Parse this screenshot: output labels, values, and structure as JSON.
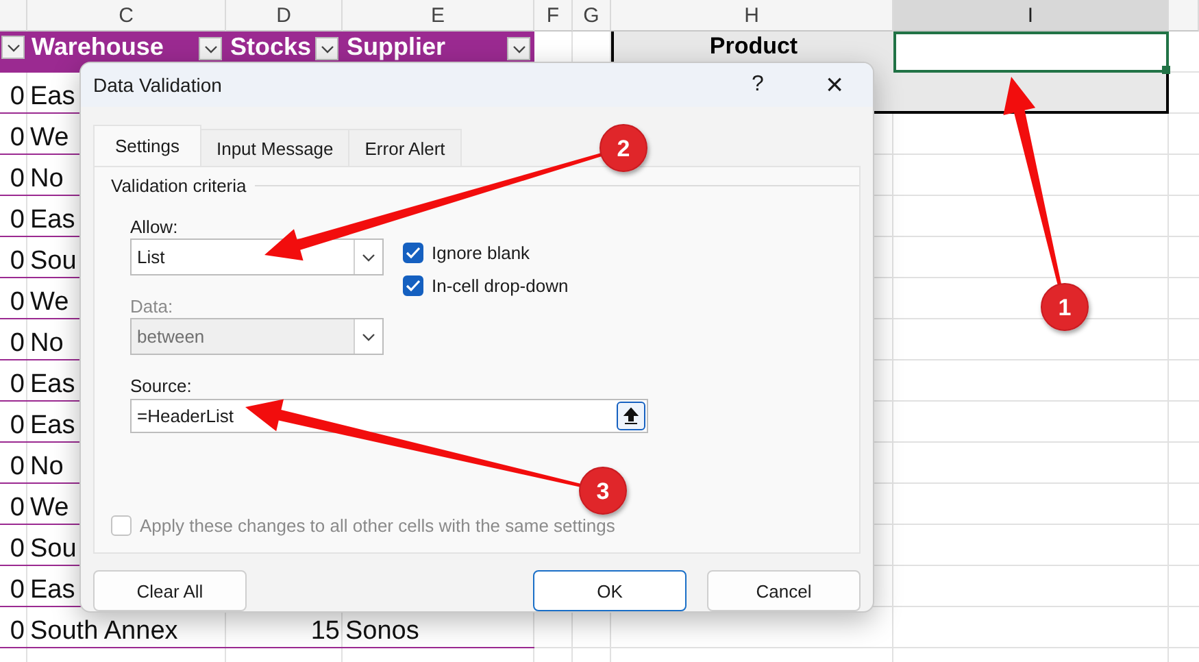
{
  "sheet": {
    "columns": [
      {
        "label": "C",
        "selected": false
      },
      {
        "label": "D",
        "selected": false
      },
      {
        "label": "E",
        "selected": false
      },
      {
        "label": "F",
        "selected": false
      },
      {
        "label": "G",
        "selected": false
      },
      {
        "label": "H",
        "selected": false
      },
      {
        "label": "I",
        "selected": true
      }
    ],
    "table_headers": [
      "Warehouse",
      "Stocks",
      "Supplier"
    ],
    "rows": [
      {
        "column_b": "0",
        "warehouse": "Eas"
      },
      {
        "column_b": "0",
        "warehouse": "We"
      },
      {
        "column_b": "0",
        "warehouse": "No"
      },
      {
        "column_b": "0",
        "warehouse": "Eas"
      },
      {
        "column_b": "0",
        "warehouse": "Sou"
      },
      {
        "column_b": "0",
        "warehouse": "We"
      },
      {
        "column_b": "0",
        "warehouse": "No"
      },
      {
        "column_b": "0",
        "warehouse": "Eas"
      },
      {
        "column_b": "0",
        "warehouse": "Eas"
      },
      {
        "column_b": "0",
        "warehouse": "No"
      },
      {
        "column_b": "0",
        "warehouse": "We"
      },
      {
        "column_b": "0",
        "warehouse": "Sou"
      },
      {
        "column_b": "0",
        "warehouse": "Eas"
      },
      {
        "column_b": "0",
        "warehouse": "South Annex",
        "stocks": "15",
        "supplier": "Sonos"
      }
    ],
    "product_header": "Product"
  },
  "dialog": {
    "title": "Data Validation",
    "help": "?",
    "close": "×",
    "tabs": [
      {
        "label": "Settings",
        "selected": true
      },
      {
        "label": "Input Message",
        "selected": false
      },
      {
        "label": "Error Alert",
        "selected": false
      }
    ],
    "group_label": "Validation criteria",
    "allow": {
      "label": "Allow:",
      "value": "List",
      "disabled": false
    },
    "data": {
      "label": "Data:",
      "value": "between",
      "disabled": true
    },
    "checkboxes": [
      {
        "label": "Ignore blank",
        "checked": true
      },
      {
        "label": "In-cell drop-down",
        "checked": true
      }
    ],
    "source": {
      "label": "Source:",
      "value": "=HeaderList"
    },
    "apply": {
      "label": "Apply these changes to all other cells with the same settings",
      "checked": false,
      "disabled": true
    },
    "buttons": [
      {
        "label": "Clear All",
        "kind": "normal"
      },
      {
        "label": "OK",
        "kind": "default"
      },
      {
        "label": "Cancel",
        "kind": "normal"
      }
    ]
  },
  "annotations": [
    {
      "number": "1"
    },
    {
      "number": "2"
    },
    {
      "number": "3"
    }
  ]
}
